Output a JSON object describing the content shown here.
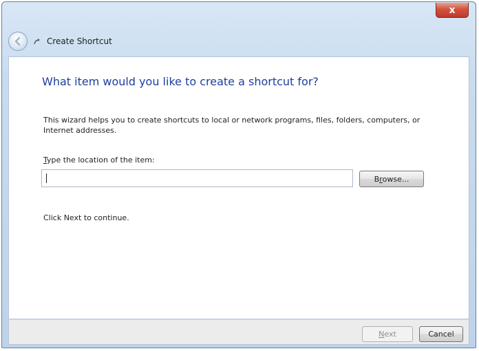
{
  "window": {
    "title": "Create Shortcut",
    "close_symbol": "x",
    "title_color": "#1b3f9d"
  },
  "icons": {
    "back": "back-arrow-icon",
    "shortcut": "shortcut-arrow-icon",
    "close": "close-icon"
  },
  "content": {
    "heading": "What item would you like to create a shortcut for?",
    "description": "This wizard helps you to create shortcuts to local or network programs, files, folders, computers, or Internet addresses.",
    "field_label_first": "T",
    "field_label_rest": "ype the location of the item:",
    "location_value": "",
    "browse_first": "B",
    "browse_u": "r",
    "browse_rest": "owse...",
    "continue_text": "Click Next to continue."
  },
  "footer": {
    "next_u": "N",
    "next_rest": "ext",
    "cancel_label": "Cancel"
  }
}
